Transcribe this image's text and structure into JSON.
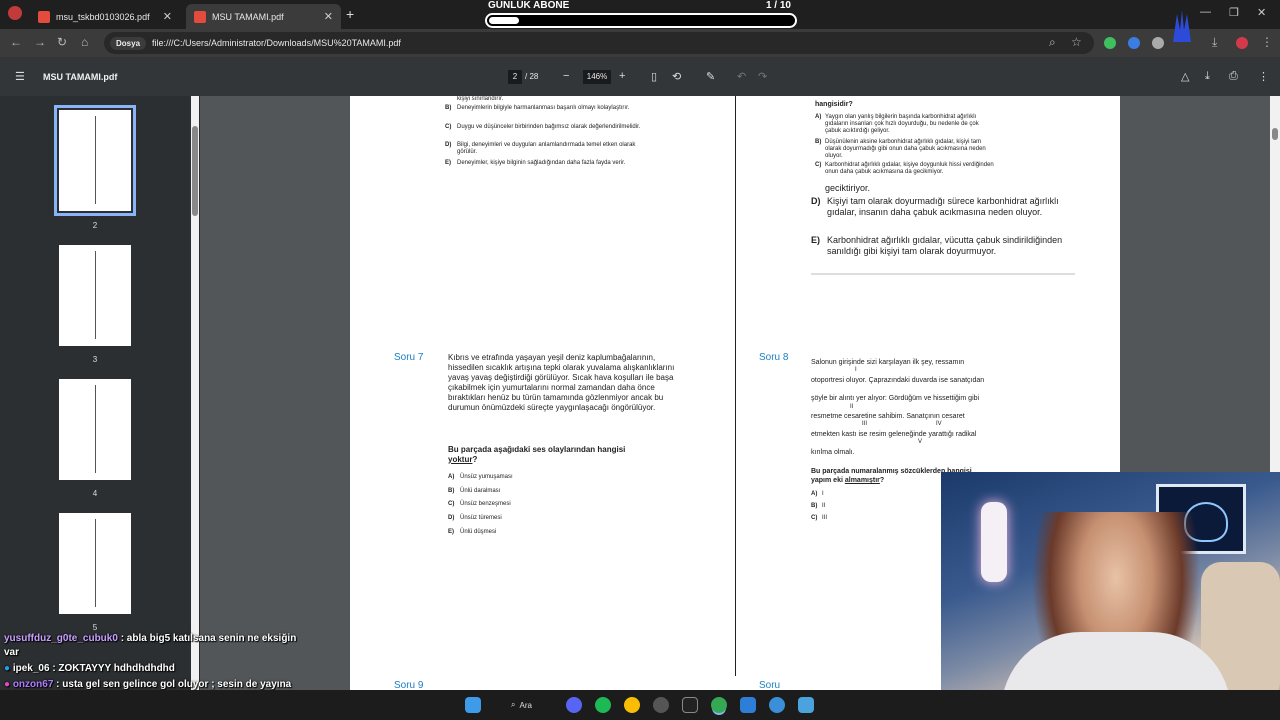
{
  "browser": {
    "tabs": [
      {
        "label": "msu_tskbd0103026.pdf",
        "active": false
      },
      {
        "label": "MSU TAMAMI.pdf",
        "active": true
      }
    ],
    "address_chip": "Dosya",
    "url": "file:///C:/Users/Administrator/Downloads/MSU%20TAMAMI.pdf"
  },
  "pdf": {
    "filename": "MSU TAMAMI.pdf",
    "current_page": "2",
    "total_pages": "/ 28",
    "zoom": "146%"
  },
  "thumbnails": [
    {
      "num": "2",
      "selected": true
    },
    {
      "num": "3",
      "selected": false
    },
    {
      "num": "4",
      "selected": false
    },
    {
      "num": "5",
      "selected": false
    }
  ],
  "page_left_top": {
    "line0": "kişiyi sınırlandırır.",
    "B": "Deneyimlerin bilgiyle harmanlanması başarılı olmayı kolaylaştırır.",
    "C": "Duygu ve düşünceler birbirinden bağımsız olarak değerlendirilmelidir.",
    "D": "Bilgi, deneyimleri ve duyguları anlamlandırmada temel etken olarak görülür.",
    "E": "Deneyimler, kişiye bilginin sağladığından daha fazla fayda verir."
  },
  "page_right_top": {
    "q": "hangisidir?",
    "A": "Yaygın olan yanlış bilgilerin başında karbonhidrat ağırlıklı gıdaların insanları çok hızlı doyurduğu, bu nedenle de çok çabuk acıktırdığı geliyor.",
    "B": "Düşünülenin aksine karbonhidrat ağırlıklı gıdalar, kişiyi tam olarak doyurmadığı gibi onun daha çabuk acıkmasına neden oluyor.",
    "C": "Karbonhidrat ağırlıklı gıdalar, kişiye doygunluk hissi verdiğinden onun daha çabuk acıkmasına da gecikmiyor.",
    "C_cont": "geciktiriyor.",
    "D": "Kişiyi tam olarak doyurmadığı sürece karbonhidrat ağırlıklı gıdalar, insanın daha çabuk acıkmasına neden oluyor.",
    "E": "Karbonhidrat ağırlıklı gıdalar, vücutta çabuk sindirildiğinden sanıldığı gibi kişiyi tam olarak doyurmuyor."
  },
  "soru7": {
    "label": "Soru 7",
    "passage": "Kıbrıs ve etrafında yaşayan yeşil deniz kaplumbağalarının, hissedilen sıcaklık artışına tepki olarak yuvalama alışkanlıklarını yavaş yavaş değiştirdiği görülüyor. Sıcak hava koşulları ile başa çıkabilmek için yumurtalarını normal zamandan daha önce bıraktıkları henüz bu türün tamamında gözlenmiyor ancak bu durumun önümüzdeki süreçte yaygınlaşacağı öngörülüyor.",
    "question": "Bu parçada aşağıdaki ses olaylarından hangisi",
    "question_u": "yoktur",
    "options": [
      {
        "k": "A)",
        "v": "Ünsüz yumuşaması"
      },
      {
        "k": "B)",
        "v": "Ünlü daralması"
      },
      {
        "k": "C)",
        "v": "Ünsüz benzeşmesi"
      },
      {
        "k": "D)",
        "v": "Ünsüz türemesi"
      },
      {
        "k": "E)",
        "v": "Ünlü düşmesi"
      }
    ]
  },
  "soru8": {
    "label": "Soru 8",
    "lines": [
      "Salonun girişinde sizi karşılayan ilk şey, ressamın",
      "otoportresi oluyor. Çaprazındaki duvarda ise sanatçıdan",
      "şöyle bir alıntı yer alıyor: Gördüğüm ve hissettiğim gibi",
      "resmetme cesaretine sahibim. Sanatçının cesaret",
      "etmekten kastı ise resim geleneğinde yarattığı radikal",
      "kırılma olmalı."
    ],
    "numerals": [
      "I",
      "II",
      "III",
      "IV",
      "V"
    ],
    "question": "Bu parçada numaralanmış sözcüklerden hangisi",
    "question2": "yapım eki",
    "question_u": "almamıştır",
    "options": [
      {
        "k": "A)",
        "v": "I"
      },
      {
        "k": "B)",
        "v": "II"
      },
      {
        "k": "C)",
        "v": "III"
      }
    ]
  },
  "next_labels": {
    "left": "Soru 9",
    "right": "Soru"
  },
  "overlay": {
    "title": "GÜNLÜK ABONE",
    "count": "1 / 10",
    "progress_fraction": 0.1
  },
  "chat": [
    {
      "user": "yusuffduz_g0te_cubuk0",
      "color": "#c9a0ff",
      "text": ": abla big5 katılsana senin ne eksiğin var"
    },
    {
      "user": "ipek_06",
      "color": "#ffffff",
      "text": ": ZOKTAYYY hdhdhdhdhd"
    },
    {
      "user": "onzon67",
      "color": "#b07bff",
      "text": ": usta gel sen gelince gol oluyor ; sesin de yayına gelsin"
    }
  ],
  "taskbar": {
    "search_label": "Ara"
  },
  "colors": {
    "accent": "#1a7fc4",
    "selection": "#8ab4f8"
  }
}
